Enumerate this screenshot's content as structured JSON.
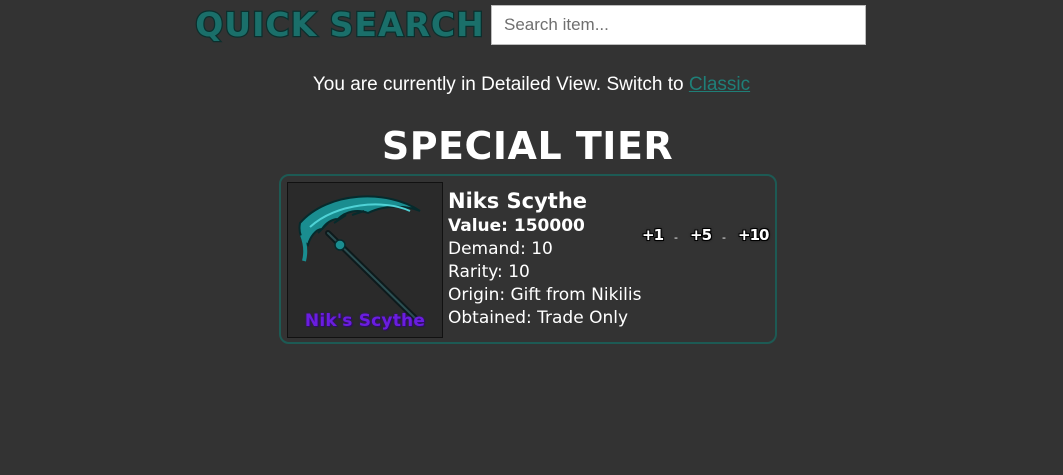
{
  "search": {
    "logo_text": "QUICK SEARCH",
    "placeholder": "Search item...",
    "value": ""
  },
  "view_switch": {
    "prefix": "You are currently in Detailed View. Switch to",
    "link_label": "Classic"
  },
  "tier": {
    "title": "SPECIAL TIER"
  },
  "item": {
    "name": "Niks Scythe",
    "value_line": "Value: 150000",
    "demand_line": "Demand: 10",
    "rarity_line": "Rarity: 10",
    "origin_line": "Origin: Gift from Nikilis",
    "obtained_line": "Obtained: Trade Only",
    "image_caption": "Nik's Scythe",
    "buttons": [
      "+1",
      "+5",
      "+10"
    ],
    "separator": "-"
  },
  "colors": {
    "background": "#333333",
    "accent_teal": "#1f7f78",
    "card_border": "#1d5a54",
    "caption_purple": "#6a1de0"
  },
  "icons": {
    "logo": "quick-search-logo",
    "item_image": "scythe-icon"
  }
}
